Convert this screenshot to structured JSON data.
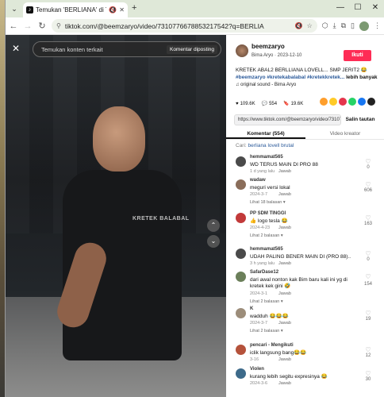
{
  "browser": {
    "tab_title": "Temukan 'BERLIANA' di TikTok",
    "url": "tiktok.com/@beemzaryo/video/7310776678853217542?q=BERLIA"
  },
  "video": {
    "search_placeholder": "Temukan konten terkait",
    "highlight_button": "Komentar diposting",
    "shirt_text": "KRETEK BALABAL"
  },
  "creator": {
    "username": "beemzaryo",
    "subtitle": "Bima Aryo · 2023-12-10",
    "follow_label": "Ikuti",
    "caption": "KRETEK ABAL2 BERLLIANA LOVELL... SMP JERIT2 😂",
    "hashtags": "#beemzaryo #kretekabalabal #kretekkretek...",
    "more_label": "lebih banyak",
    "sound": "♫  original sound - Bima Aryo"
  },
  "stats": {
    "likes": "109.6K",
    "comments": "554",
    "saves": "19.6K"
  },
  "share": {
    "link": "https://www.tiktok.com/@beemzaryo/video/7310777...",
    "copy_label": "Salin tautan",
    "colors": [
      "#fe9e2c",
      "#ffca28",
      "#e5354c",
      "#25d366",
      "#1877f2",
      "#222222"
    ]
  },
  "tabs": {
    "comments": "Komentar (554)",
    "creator": "Video kreator"
  },
  "search_suggest": {
    "prefix": "Cari:",
    "term": "berliana lovell brutal"
  },
  "comments": [
    {
      "user": "hemmamat565",
      "text": "WD TERUS MAIN DI PRO 88",
      "date": "1 d yang lalu",
      "reply": "Jawab",
      "likes": "0",
      "more": "",
      "avatar": "#4a4a4a"
    },
    {
      "user": "wadaw",
      "text": "meguri versi lokal",
      "date": "2024-3-7",
      "reply": "Jawab",
      "likes": "606",
      "more": "Lihat 18 balasan ▾",
      "avatar": "#8a6d5a"
    },
    {
      "user": "PP SDM TINGGI",
      "text": "👍 logo tesla 😂",
      "date": "2024-4-23",
      "reply": "Jawab",
      "likes": "163",
      "more": "Lihat 2 balasan ▾",
      "avatar": "#c23a3a"
    },
    {
      "user": "hemmamat565",
      "text": "UDAH PALING BENER MAIN DI (PRO 88)..",
      "date": "3 h yang lalu",
      "reply": "Jawab",
      "likes": "0",
      "more": "",
      "avatar": "#4a4a4a"
    },
    {
      "user": "SafarDase12",
      "text": "dari awal nonton kak Bim baru kali ini yg di kretek kek gini 🤣",
      "date": "2024-3-1",
      "reply": "Jawab",
      "likes": "154",
      "more": "Lihat 2 balasan ▾",
      "avatar": "#6b7f5a"
    },
    {
      "user": "K",
      "text": "wadduh 😂😂😂",
      "date": "2024-3-7",
      "reply": "Jawab",
      "likes": "19",
      "more": "Lihat 2 balasan ▾",
      "avatar": "#9c8d7a"
    },
    {
      "user": "pencari - Mengikuti",
      "text": "iclik langsung bang😂😂",
      "date": "3-16",
      "reply": "Jawab",
      "likes": "12",
      "more": "",
      "avatar": "#b5523b"
    },
    {
      "user": "Violen",
      "text": "kurang lebih segitu expresinya 😂",
      "date": "2024-3-6",
      "reply": "Jawab",
      "likes": "30",
      "more": "",
      "avatar": "#3d6a8a"
    }
  ]
}
